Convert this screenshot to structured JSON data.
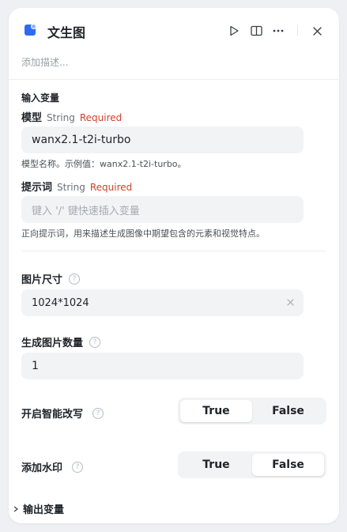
{
  "header": {
    "title": "文生图",
    "description_placeholder": "添加描述..."
  },
  "inputs": {
    "section_title": "输入变量",
    "model": {
      "label": "模型",
      "type": "String",
      "required": "Required",
      "value": "wanx2.1-t2i-turbo",
      "hint": "模型名称。示例值：wanx2.1-t2i-turbo。"
    },
    "prompt": {
      "label": "提示词",
      "type": "String",
      "required": "Required",
      "placeholder": "键入 '/' 键快速插入变量",
      "hint": "正向提示词，用来描述生成图像中期望包含的元素和视觉特点。"
    },
    "image_size": {
      "label": "图片尺寸",
      "value": "1024*1024"
    },
    "image_count": {
      "label": "生成图片数量",
      "value": "1"
    },
    "smart_rewrite": {
      "label": "开启智能改写",
      "options": [
        "True",
        "False"
      ],
      "selected": "True"
    },
    "watermark": {
      "label": "添加水印",
      "options": [
        "True",
        "False"
      ],
      "selected": "False"
    }
  },
  "outputs": {
    "section_title": "输出变量"
  },
  "colors": {
    "required": "#d2402b",
    "brand_blue": "#2f6bf2"
  }
}
